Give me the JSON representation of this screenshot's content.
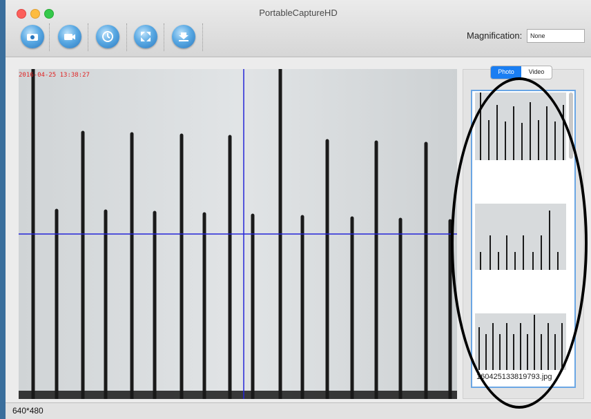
{
  "window": {
    "title": "PortableCaptureHD"
  },
  "toolbar": {
    "buttons": [
      {
        "icon": "camera-snapshot-icon"
      },
      {
        "icon": "video-record-icon"
      },
      {
        "icon": "timer-icon"
      },
      {
        "icon": "fullscreen-icon"
      },
      {
        "icon": "download-icon"
      }
    ],
    "magnification_label": "Magnification:",
    "magnification_value": "None"
  },
  "preview": {
    "timestamp": "2016-04-25 13:38:27"
  },
  "gallery": {
    "tabs": [
      {
        "label": "Photo",
        "active": true
      },
      {
        "label": "Video",
        "active": false
      }
    ],
    "caption": "160425133819793.jpg"
  },
  "status": {
    "resolution": "640*480"
  },
  "colors": {
    "accent": "#1a7ef2",
    "crosshair": "#2424d8",
    "annotation": "#000000",
    "timestamp": "#e02222"
  }
}
